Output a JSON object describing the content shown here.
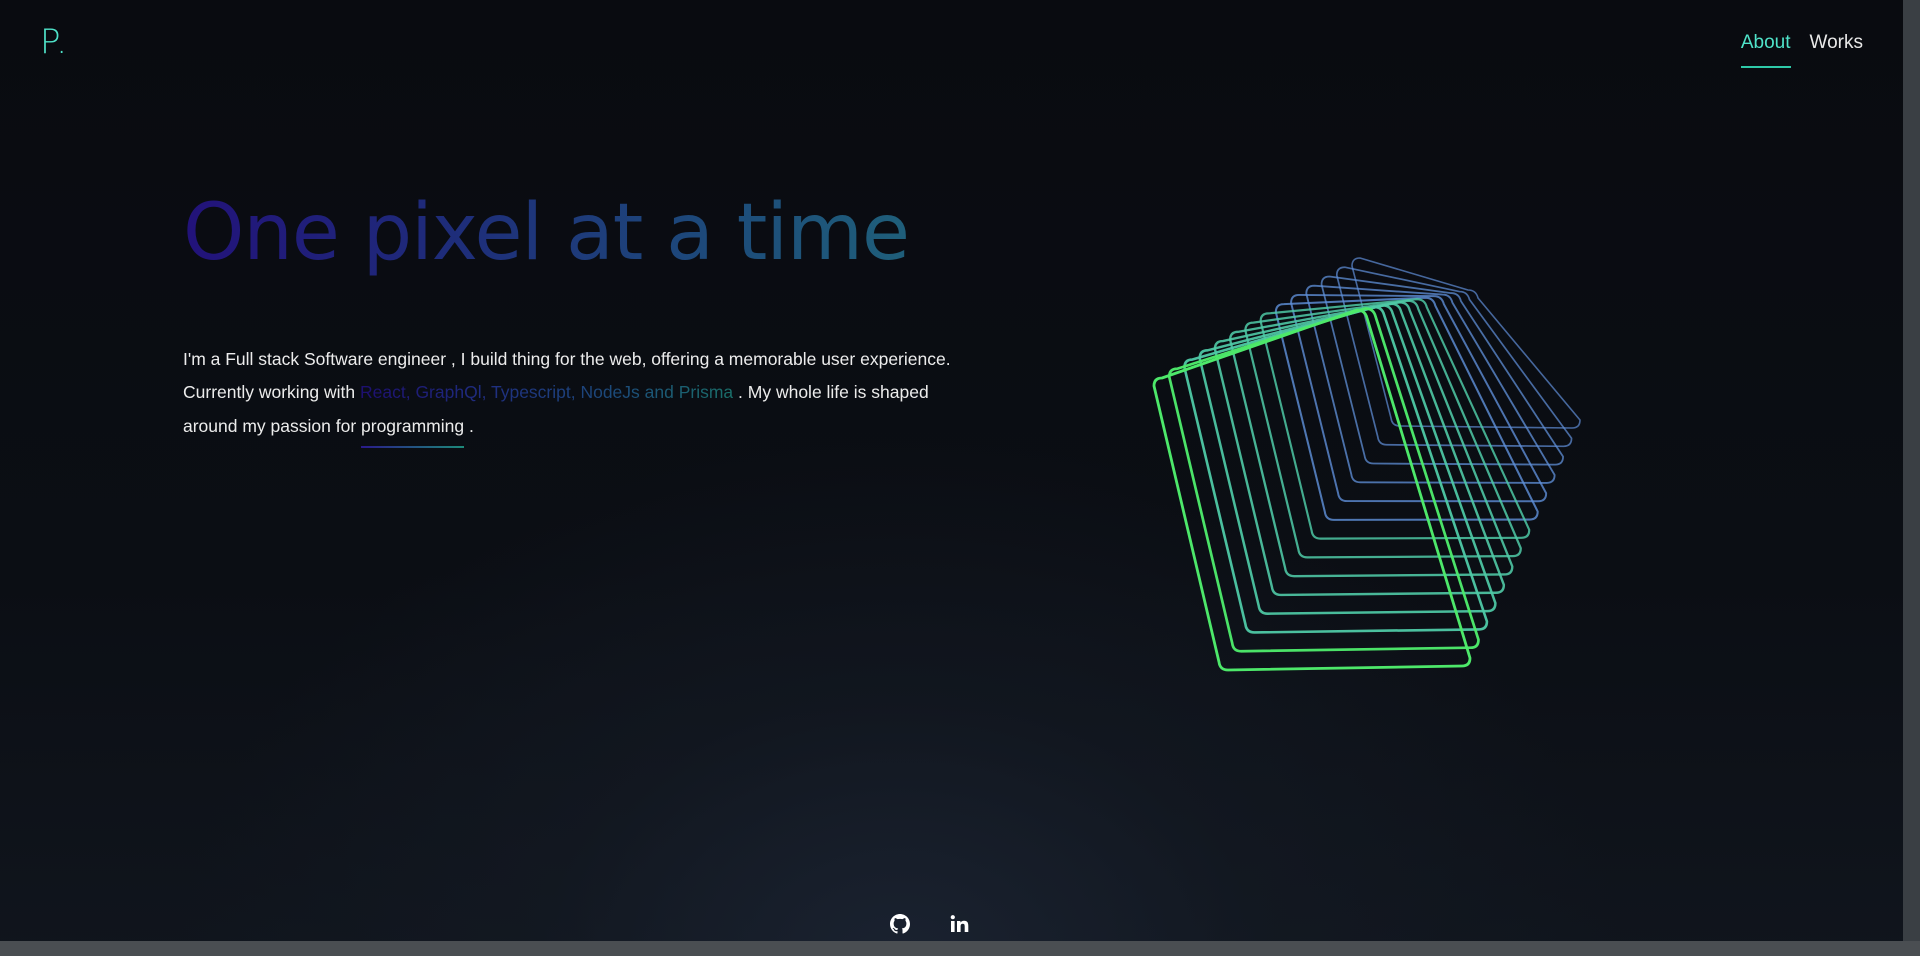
{
  "header": {
    "logo": "P.",
    "nav": [
      {
        "label": "About",
        "active": true
      },
      {
        "label": "Works",
        "active": false
      }
    ]
  },
  "hero": {
    "headline": "One pixel at a time",
    "intro": {
      "line_start": "I'm a Full stack Software engineer , I build thing for the web, offering a memorable user experience. Currently working with ",
      "tech_stack": "React, GraphQl, Typescript, NodeJs and Prisma",
      "line_middle": " . My whole life is shaped around my passion for ",
      "passion": "programming",
      "line_end": " ."
    }
  },
  "footer": {
    "socials": [
      {
        "name": "github-icon"
      },
      {
        "name": "linkedin-icon"
      }
    ]
  },
  "colors": {
    "accent": "#4fe3c9",
    "background": "#0a0c10",
    "cube_green": "#4de86a",
    "cube_blue": "#5f8fd8"
  }
}
